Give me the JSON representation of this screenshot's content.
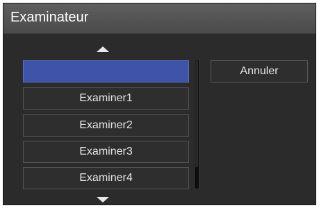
{
  "dialog": {
    "title": "Examinateur"
  },
  "list": {
    "scroll_up_icon": "triangle-up",
    "scroll_down_icon": "triangle-down",
    "items": [
      {
        "label": "",
        "selected": true
      },
      {
        "label": "Examiner1",
        "selected": false
      },
      {
        "label": "Examiner2",
        "selected": false
      },
      {
        "label": "Examiner3",
        "selected": false
      },
      {
        "label": "Examiner4",
        "selected": false
      }
    ]
  },
  "actions": {
    "cancel_label": "Annuler"
  },
  "colors": {
    "selection": "#3f54a8",
    "background": "#2b2b2b",
    "titlebar": "#555555",
    "text": "#e6e6e6"
  }
}
